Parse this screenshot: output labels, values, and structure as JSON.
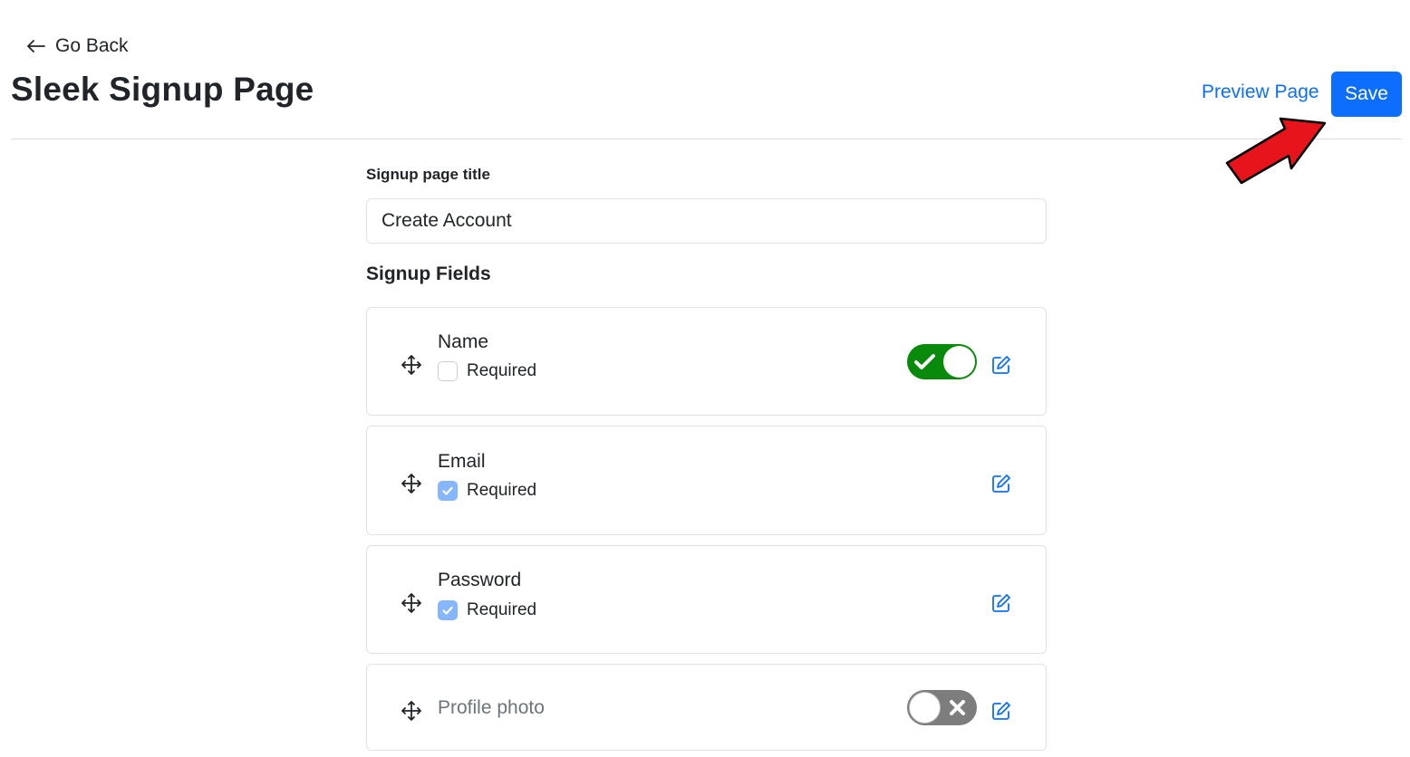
{
  "header": {
    "back_label": "Go Back",
    "title": "Sleek Signup Page",
    "preview_label": "Preview Page",
    "save_label": "Save"
  },
  "form": {
    "title_label": "Signup page title",
    "title_value": "Create Account",
    "fields_heading": "Signup Fields"
  },
  "fields": [
    {
      "name": "Name",
      "required_label": "Required",
      "required": false,
      "enabled": true
    },
    {
      "name": "Email",
      "required_label": "Required",
      "required": true
    },
    {
      "name": "Password",
      "required_label": "Required",
      "required": true
    },
    {
      "name": "Profile photo",
      "enabled": false
    }
  ],
  "icons": {
    "back": "arrow-left-icon",
    "drag": "move-arrows-icon",
    "edit": "pencil-square-icon",
    "toggle_on": "check-icon",
    "toggle_off": "x-icon",
    "annotation": "red-arrow-annotation"
  },
  "colors": {
    "primary": "#0d6efd",
    "toggle_on": "#0a8a0a",
    "toggle_off": "#7d7d7d",
    "checkbox_checked": "#86b7fe",
    "annotation": "#e8141c"
  }
}
